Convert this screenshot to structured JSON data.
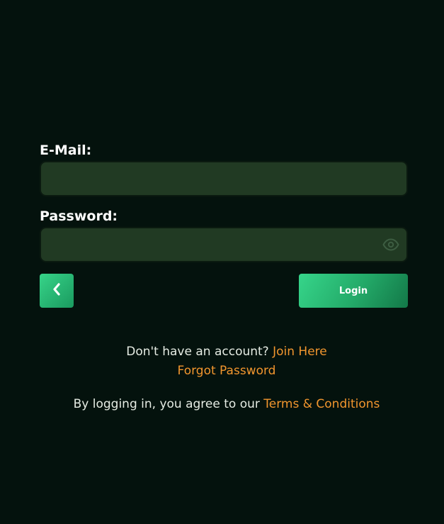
{
  "form": {
    "email_label": "E-Mail:",
    "email_value": "",
    "password_label": "Password:",
    "password_value": "",
    "show_password_icon": "eye-icon",
    "back_icon": "chevron-left-icon",
    "login_label": "Login"
  },
  "links": {
    "no_account_text": "Don't have an account?",
    "join_label": "Join Here",
    "forgot_label": "Forgot Password",
    "agree_text": "By logging in, you agree to our",
    "terms_label": "Terms & Conditions"
  },
  "colors": {
    "background": "#04120d",
    "input_bg": "#213a23",
    "accent_green": "#2bc47a",
    "link_orange": "#f2962e"
  }
}
